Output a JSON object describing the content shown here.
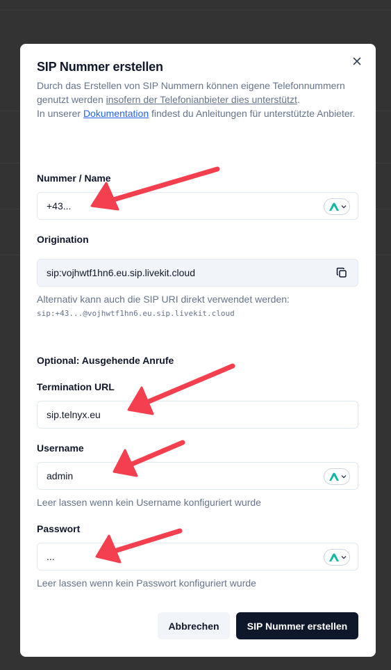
{
  "modal": {
    "title": "SIP Nummer erstellen",
    "desc": {
      "part1": "Durch das Erstellen von SIP Nummern können eigene Telefonnummern genutzt werden ",
      "link": "insofern der Telefonianbieter dies unterstützt",
      "part2": ".",
      "part3": "In unserer ",
      "doc_link": "Dokumentation",
      "part4": " findest du Anleitungen für unterstützte Anbieter."
    },
    "close_icon": "close-icon"
  },
  "number_field": {
    "label": "Nummer / Name",
    "value": "+43..."
  },
  "origination": {
    "label": "Origination",
    "value": "sip:vojhwtf1hn6.eu.sip.livekit.cloud",
    "hint": "Alternativ kann auch die SIP URI direkt verwendet werden:",
    "uri": "sip:+43...@vojhwtf1hn6.eu.sip.livekit.cloud"
  },
  "outbound": {
    "heading": "Optional: Ausgehende Anrufe"
  },
  "termination": {
    "label": "Termination URL",
    "value": "sip.telnyx.eu"
  },
  "username": {
    "label": "Username",
    "value": "admin",
    "hint": "Leer lassen wenn kein Username konfiguriert wurde"
  },
  "password": {
    "label": "Passwort",
    "value": "...",
    "hint": "Leer lassen wenn kein Passwort konfiguriert wurde"
  },
  "actions": {
    "cancel": "Abbrechen",
    "create": "SIP Nummer erstellen"
  },
  "colors": {
    "overlay": "#333333",
    "primary": "#0f172a",
    "link": "#2563eb",
    "arrow": "#f43f4e",
    "password_manager": "#10b9a0"
  }
}
